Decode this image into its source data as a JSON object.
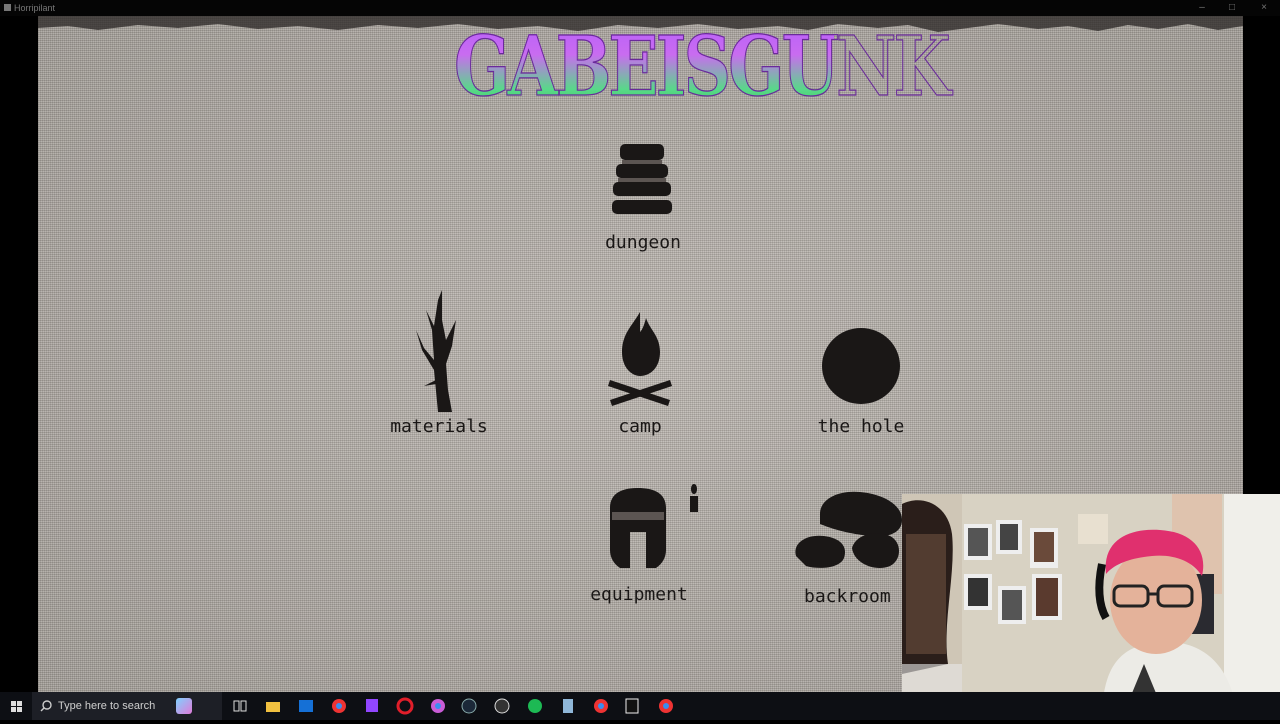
{
  "window": {
    "title": "Horripilant"
  },
  "game": {
    "logo": "GABEISGUNK",
    "locations": [
      {
        "id": "dungeon",
        "label": "dungeon"
      },
      {
        "id": "materials",
        "label": "materials"
      },
      {
        "id": "camp",
        "label": "camp"
      },
      {
        "id": "hole",
        "label": "the hole"
      },
      {
        "id": "equipment",
        "label": "equipment"
      },
      {
        "id": "backroom",
        "label": "backroom"
      }
    ]
  },
  "taskbar": {
    "search_placeholder": "Type here to search",
    "icons": [
      "windows-start-icon",
      "search-icon",
      "cortana-icon",
      "task-view-icon",
      "file-explorer-icon",
      "outlook-icon",
      "chrome-icon",
      "twitch-icon",
      "opera-icon",
      "chrome-icon",
      "steam-icon",
      "obs-icon",
      "spotify-icon",
      "notepad-icon",
      "chrome-icon",
      "app-icon",
      "chrome-icon"
    ]
  },
  "colors": {
    "parchment": "#b9b3ac",
    "ink": "#1a1716",
    "logo_purple": "#b25bff",
    "logo_green": "#2ecc40"
  }
}
